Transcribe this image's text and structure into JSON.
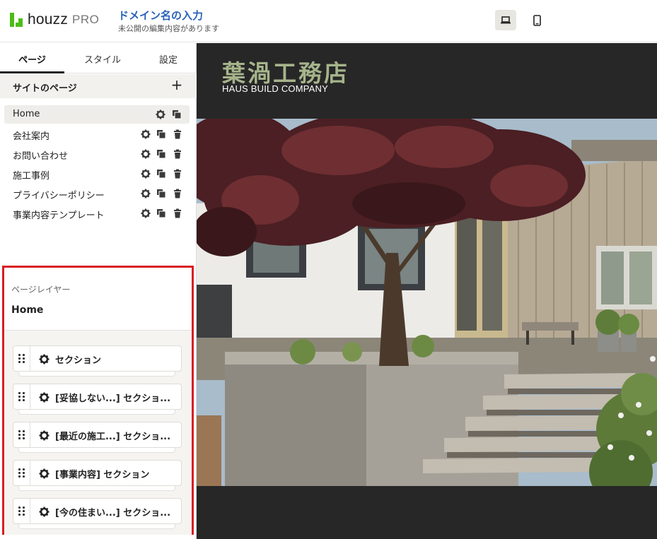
{
  "header": {
    "logo_text": "houzz",
    "logo_pro": "PRO",
    "domain_title": "ドメイン名の入力",
    "domain_sub": "未公開の編集内容があります",
    "device_desktop_icon": "laptop-icon",
    "device_mobile_icon": "mobile-icon"
  },
  "sidebar": {
    "tabs": [
      {
        "label": "ページ",
        "active": true
      },
      {
        "label": "スタイル",
        "active": false
      },
      {
        "label": "設定",
        "active": false
      }
    ],
    "pages_title": "サイトのページ",
    "add_label": "+",
    "pages": [
      {
        "label": "Home",
        "active": true
      },
      {
        "label": "会社案内"
      },
      {
        "label": "お問い合わせ"
      },
      {
        "label": "施工事例"
      },
      {
        "label": "プライバシーポリシー"
      },
      {
        "label": "事業内容テンプレート"
      }
    ],
    "layers": {
      "label": "ページレイヤー",
      "page_name": "Home",
      "sections": [
        {
          "label": "セクション"
        },
        {
          "label": "[妥協しない...] セクショ..."
        },
        {
          "label": "[最近の施工...] セクショ..."
        },
        {
          "label": "[事業内容] セクション"
        },
        {
          "label": "[今の住まい...] セクショ..."
        }
      ]
    }
  },
  "preview": {
    "brand_jp": "葉渦工務店",
    "brand_en": "HAUS BUILD COMPANY",
    "colors": {
      "brand": "#a6b48b",
      "background": "#272727"
    }
  },
  "colors": {
    "accent": "#2a64b8",
    "logo": "#4dbc15",
    "highlight_border": "#d81e25"
  }
}
